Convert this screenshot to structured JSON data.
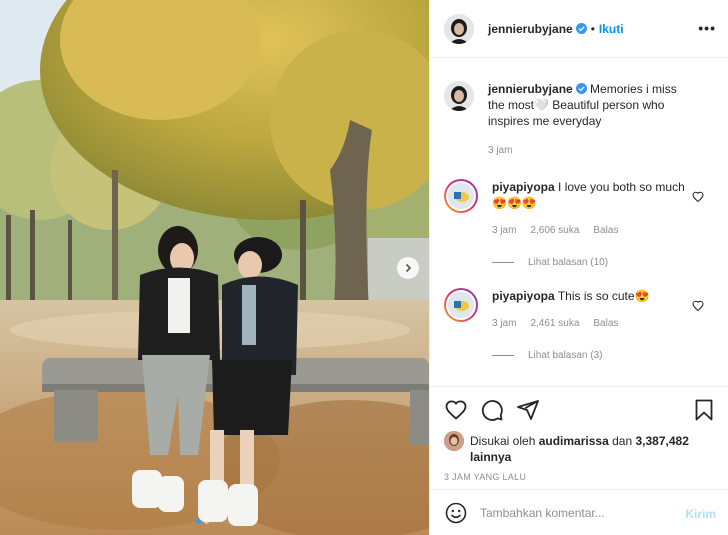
{
  "post": {
    "username": "jennierubyjane",
    "follow_label": "Ikuti",
    "dot": "•",
    "more_label": "•••"
  },
  "caption": {
    "username": "jennierubyjane",
    "text": "Memories i miss the most🤍 Beautiful person who inspires me everyday",
    "time": "3 jam"
  },
  "comments": [
    {
      "username": "piyapiyopa",
      "text": "I love you both so much😍😍😍",
      "time": "3 jam",
      "likes": "2,606 suka",
      "reply_label": "Balas",
      "view_replies": "Lihat balasan (10)"
    },
    {
      "username": "piyapiyopa",
      "text": "This is so cute😍",
      "time": "3 jam",
      "likes": "2,461 suka",
      "reply_label": "Balas",
      "view_replies": "Lihat balasan (3)"
    }
  ],
  "likes": {
    "prefix": "Disukai oleh",
    "user": "audimarissa",
    "conjunction": "dan",
    "count": "3,387,482 lainnya"
  },
  "time_ago": "3 JAM YANG LALU",
  "composer": {
    "placeholder": "Tambahkan komentar...",
    "post_label": "Kirim"
  },
  "carousel": {
    "slides": 2,
    "active": 0,
    "accent": "#3897f0"
  },
  "colors": {
    "link": "#0095f6",
    "verified": "#3897f0",
    "muted": "#8e8e8e",
    "border": "#efefef"
  },
  "icons": [
    "verified-icon",
    "more-icon",
    "heart-icon",
    "comment-icon",
    "share-icon",
    "bookmark-icon",
    "emoji-icon",
    "chevron-right-icon"
  ]
}
